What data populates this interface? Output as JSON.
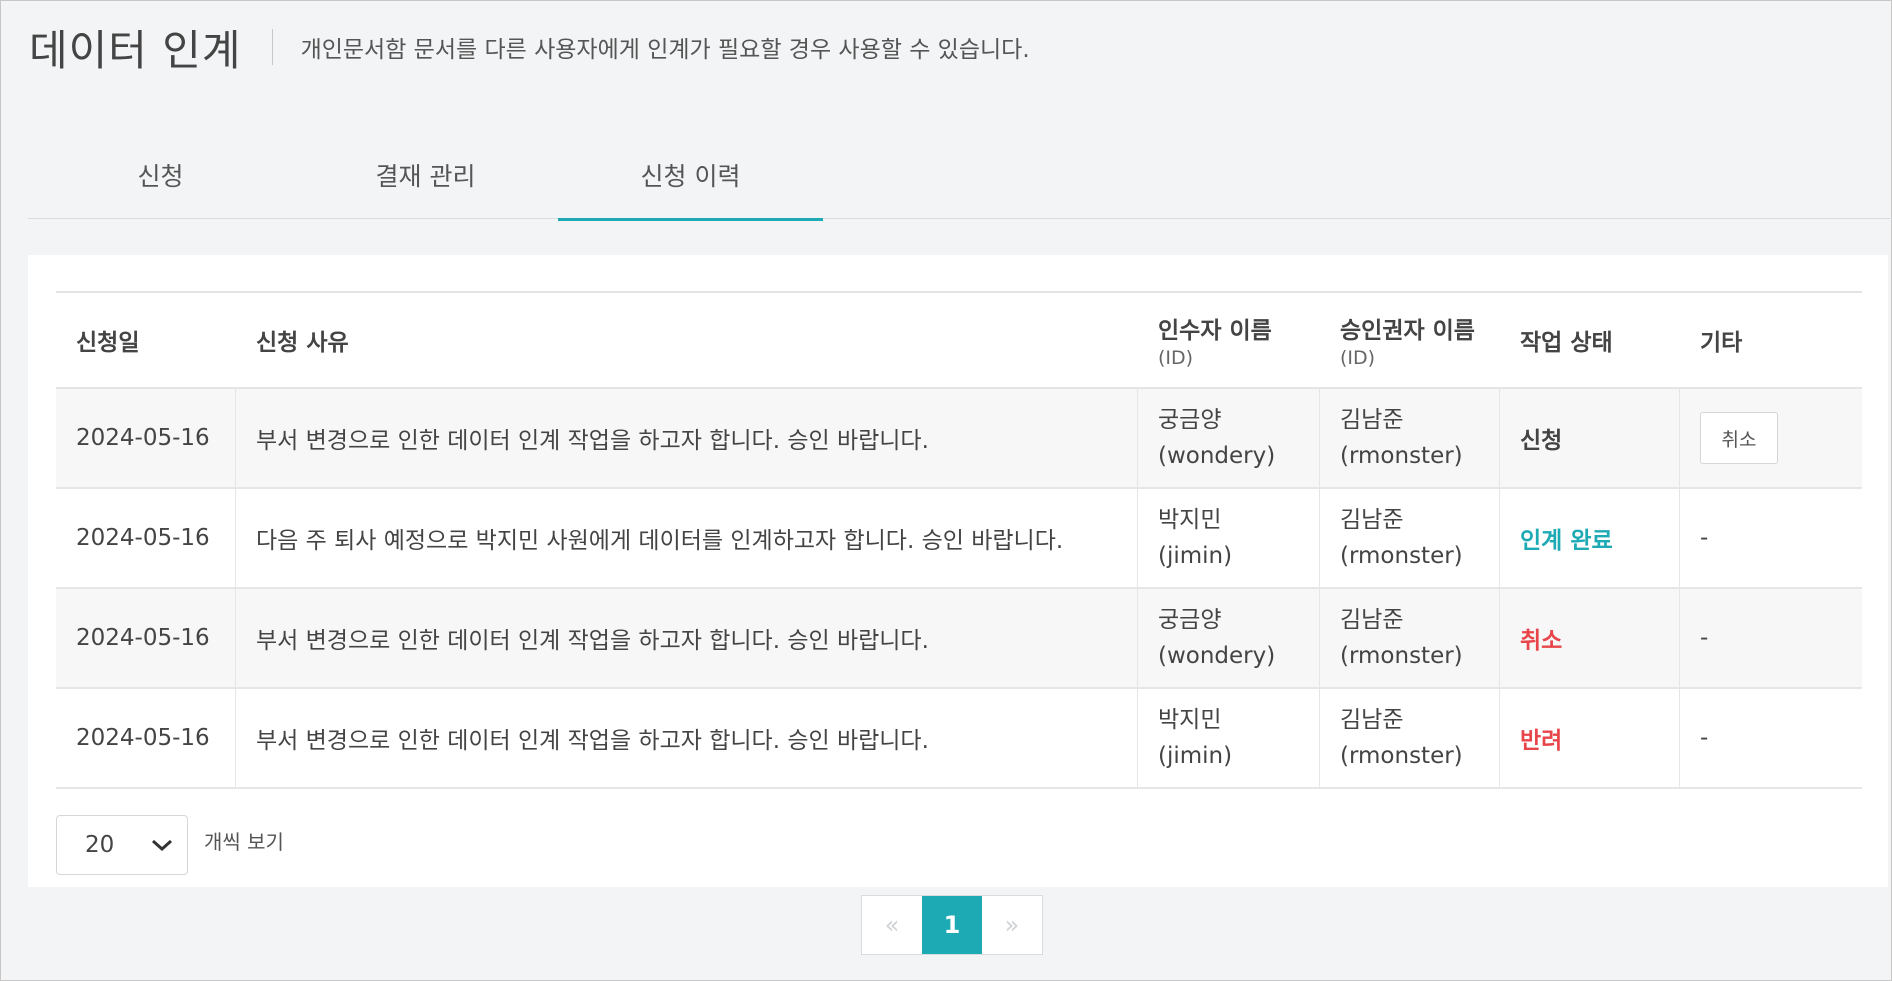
{
  "header": {
    "title": "데이터 인계",
    "description": "개인문서함 문서를 다른 사용자에게 인계가 필요할 경우 사용할 수 있습니다."
  },
  "tabs": [
    {
      "label": "신청",
      "active": false
    },
    {
      "label": "결재 관리",
      "active": false
    },
    {
      "label": "신청 이력",
      "active": true
    }
  ],
  "table": {
    "columns": [
      {
        "label": "신청일",
        "sub": ""
      },
      {
        "label": "신청 사유",
        "sub": ""
      },
      {
        "label": "인수자 이름",
        "sub": "(ID)"
      },
      {
        "label": "승인권자 이름",
        "sub": "(ID)"
      },
      {
        "label": "작업 상태",
        "sub": ""
      },
      {
        "label": "기타",
        "sub": ""
      }
    ],
    "rows": [
      {
        "date": "2024-05-16",
        "reason": "부서 변경으로 인한 데이터 인계 작업을 하고자 합니다. 승인 바랍니다.",
        "receiver_name": "궁금양",
        "receiver_id": "(wondery)",
        "approver_name": "김남준",
        "approver_id": "(rmonster)",
        "status": "신청",
        "etc": "취소"
      },
      {
        "date": "2024-05-16",
        "reason": "다음 주 퇴사 예정으로 박지민 사원에게 데이터를 인계하고자 합니다. 승인 바랍니다.",
        "receiver_name": "박지민",
        "receiver_id": "(jimin)",
        "approver_name": "김남준",
        "approver_id": "(rmonster)",
        "status": "인계 완료",
        "etc": "-"
      },
      {
        "date": "2024-05-16",
        "reason": "부서 변경으로 인한 데이터 인계 작업을 하고자 합니다. 승인 바랍니다.",
        "receiver_name": "궁금양",
        "receiver_id": "(wondery)",
        "approver_name": "김남준",
        "approver_id": "(rmonster)",
        "status": "취소",
        "etc": "-"
      },
      {
        "date": "2024-05-16",
        "reason": "부서 변경으로 인한 데이터 인계 작업을 하고자 합니다. 승인 바랍니다.",
        "receiver_name": "박지민",
        "receiver_id": "(jimin)",
        "approver_name": "김남준",
        "approver_id": "(rmonster)",
        "status": "반려",
        "etc": "-"
      }
    ]
  },
  "page_size": {
    "value": "20",
    "label": "개씩 보기"
  },
  "pagination": {
    "prev": "«",
    "current": "1",
    "next": "»"
  },
  "colors": {
    "accent": "#1eaab4",
    "danger": "#e8454b"
  }
}
